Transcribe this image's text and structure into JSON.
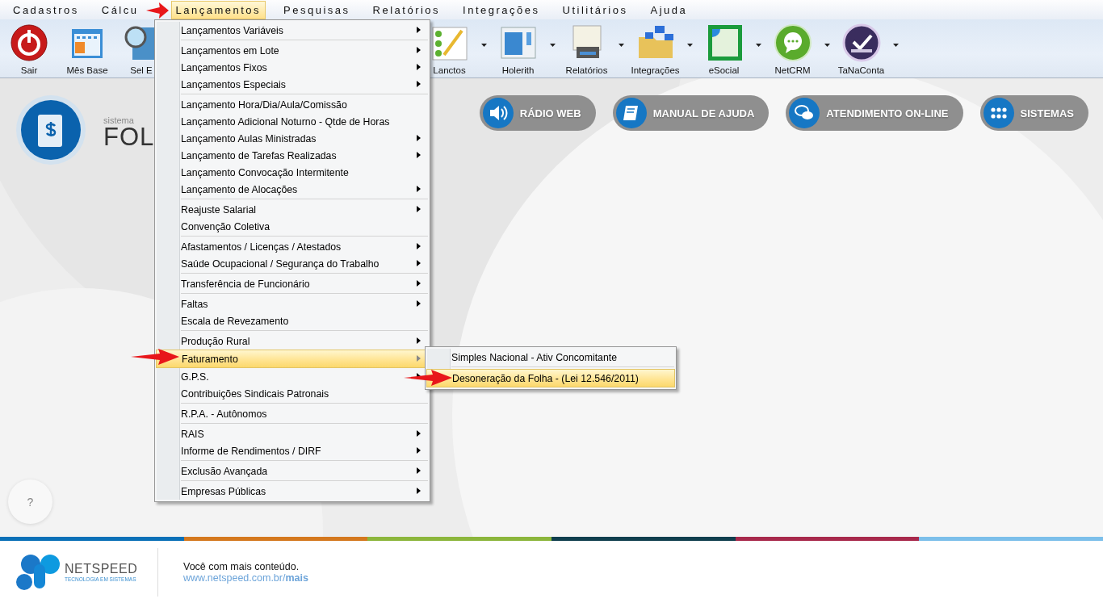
{
  "menu_bar": {
    "items": [
      {
        "label": "Cadastros",
        "selected": false
      },
      {
        "label": "Cálcu",
        "selected": false
      },
      {
        "label": "Lançamentos",
        "selected": true
      },
      {
        "label": "Pesquisas",
        "selected": false
      },
      {
        "label": "Relatórios",
        "selected": false
      },
      {
        "label": "Integrações",
        "selected": false
      },
      {
        "label": "Utilitários",
        "selected": false
      },
      {
        "label": "Ajuda",
        "selected": false
      }
    ]
  },
  "toolbar": {
    "buttons": [
      {
        "label": "Sair",
        "kind": "power",
        "dropdown": false
      },
      {
        "label": "Mês Base",
        "kind": "calendar",
        "dropdown": false
      },
      {
        "label": "Sel E",
        "kind": "building",
        "dropdown": false
      },
      {
        "label": "Lanctos",
        "kind": "checklist",
        "dropdown": true
      },
      {
        "label": "Holerith",
        "kind": "window",
        "dropdown": true
      },
      {
        "label": "Relatórios",
        "kind": "printer",
        "dropdown": true
      },
      {
        "label": "Integrações",
        "kind": "folder",
        "dropdown": true
      },
      {
        "label": "eSocial",
        "kind": "esocial",
        "dropdown": true
      },
      {
        "label": "NetCRM",
        "kind": "chat",
        "dropdown": true
      },
      {
        "label": "TaNaConta",
        "kind": "check",
        "dropdown": true
      }
    ]
  },
  "header": {
    "logo": {
      "caption": "sistema",
      "title": "FOL"
    },
    "buttons": [
      {
        "label": "RÁDIO WEB",
        "kind": "speaker"
      },
      {
        "label": "MANUAL DE AJUDA",
        "kind": "book"
      },
      {
        "label": "ATENDIMENTO ON-LINE",
        "kind": "chat"
      },
      {
        "label": "SISTEMAS",
        "kind": "grid"
      }
    ]
  },
  "help_button": {
    "label": "?"
  },
  "dropdown_menu": {
    "groups": [
      {
        "items": [
          {
            "label": "Lançamentos Variáveis",
            "submenu": true,
            "selected": false
          }
        ]
      },
      {
        "items": [
          {
            "label": "Lançamentos em Lote",
            "submenu": true,
            "selected": false
          },
          {
            "label": "Lançamentos Fixos",
            "submenu": true,
            "selected": false
          },
          {
            "label": "Lançamentos Especiais",
            "submenu": true,
            "selected": false
          }
        ]
      },
      {
        "items": [
          {
            "label": "Lançamento Hora/Dia/Aula/Comissão",
            "submenu": false,
            "selected": false
          },
          {
            "label": "Lançamento Adicional Noturno - Qtde de Horas",
            "submenu": false,
            "selected": false
          },
          {
            "label": "Lançamento Aulas Ministradas",
            "submenu": true,
            "selected": false
          },
          {
            "label": "Lançamento de Tarefas Realizadas",
            "submenu": true,
            "selected": false
          },
          {
            "label": "Lançamento Convocação Intermitente",
            "submenu": false,
            "selected": false
          },
          {
            "label": "Lançamento de Alocações",
            "submenu": true,
            "selected": false
          }
        ]
      },
      {
        "items": [
          {
            "label": "Reajuste Salarial",
            "submenu": true,
            "selected": false
          },
          {
            "label": "Convenção Coletiva",
            "submenu": false,
            "selected": false
          }
        ]
      },
      {
        "items": [
          {
            "label": "Afastamentos / Licenças / Atestados",
            "submenu": true,
            "selected": false
          },
          {
            "label": "Saúde Ocupacional / Segurança do Trabalho",
            "submenu": true,
            "selected": false
          }
        ]
      },
      {
        "items": [
          {
            "label": "Transferência de Funcionário",
            "submenu": true,
            "selected": false
          }
        ]
      },
      {
        "items": [
          {
            "label": "Faltas",
            "submenu": true,
            "selected": false
          },
          {
            "label": "Escala de Revezamento",
            "submenu": false,
            "selected": false
          }
        ]
      },
      {
        "items": [
          {
            "label": "Produção Rural",
            "submenu": true,
            "selected": false
          },
          {
            "label": "Faturamento",
            "submenu": true,
            "selected": true
          },
          {
            "label": "G.P.S.",
            "submenu": true,
            "selected": false
          },
          {
            "label": "Contribuições Sindicais Patronais",
            "submenu": false,
            "selected": false
          }
        ]
      },
      {
        "items": [
          {
            "label": "R.P.A. - Autônomos",
            "submenu": false,
            "selected": false
          }
        ]
      },
      {
        "items": [
          {
            "label": "RAIS",
            "submenu": true,
            "selected": false
          },
          {
            "label": "Informe de Rendimentos / DIRF",
            "submenu": true,
            "selected": false
          }
        ]
      },
      {
        "items": [
          {
            "label": "Exclusão Avançada",
            "submenu": true,
            "selected": false
          }
        ]
      },
      {
        "items": [
          {
            "label": "Empresas Públicas",
            "submenu": true,
            "selected": false
          }
        ]
      }
    ]
  },
  "submenu": {
    "groups": [
      {
        "items": [
          {
            "label": "Simples Nacional - Ativ Concomitante",
            "selected": false
          }
        ]
      },
      {
        "items": [
          {
            "label": "Desoneração da Folha - (Lei 12.546/2011)",
            "selected": true
          }
        ]
      }
    ]
  },
  "footer": {
    "stripe": [
      {
        "color": "#0a70b7"
      },
      {
        "color": "#d4781e"
      },
      {
        "color": "#8cb63c"
      },
      {
        "color": "#103f4e"
      },
      {
        "color": "#a8294c"
      },
      {
        "color": "#7cbfea"
      }
    ],
    "brand": "NETSPEED",
    "tagline": "TECNOLOGIA EM SISTEMAS",
    "text": "Você com mais conteúdo.",
    "link": "www.netspeed.com.br/**mais**"
  }
}
